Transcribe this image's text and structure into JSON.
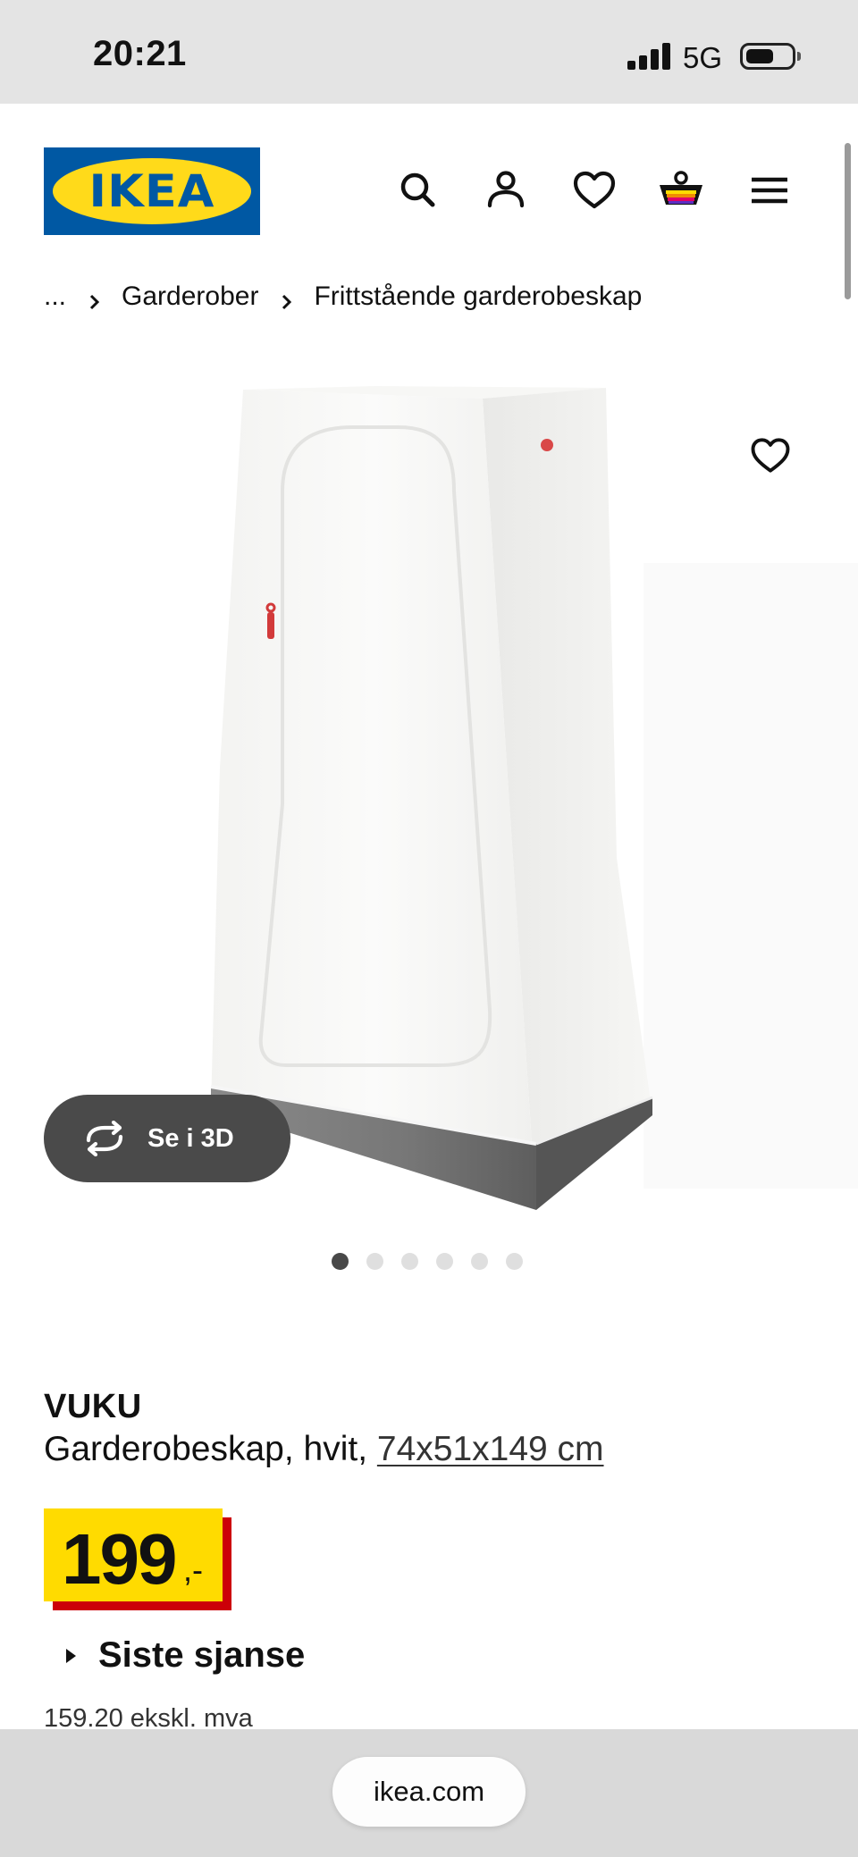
{
  "status_bar": {
    "time": "20:21",
    "network": "5G"
  },
  "header": {
    "logo_text": "IKEA",
    "icons": [
      "search-icon",
      "account-icon",
      "heart-icon",
      "basket-icon",
      "menu-icon"
    ]
  },
  "breadcrumb": {
    "ellipsis": "...",
    "items": [
      "Garderober",
      "Frittstående garderobeskap"
    ]
  },
  "gallery": {
    "view_3d_label": "Se i 3D",
    "image_count": 6,
    "active_index": 0
  },
  "product": {
    "name": "VUKU",
    "description": "Garderobeskap, hvit,",
    "dimensions": "74x51x149 cm",
    "price_integer": "199",
    "price_decimal": ",-",
    "last_chance_label": "Siste sjanse",
    "price_ex_vat": "159.20 ekskl. mva"
  },
  "browser": {
    "url": "ikea.com"
  },
  "colors": {
    "ikea_blue": "#0058a3",
    "ikea_yellow": "#ffdb00",
    "price_red": "#cc0008"
  }
}
